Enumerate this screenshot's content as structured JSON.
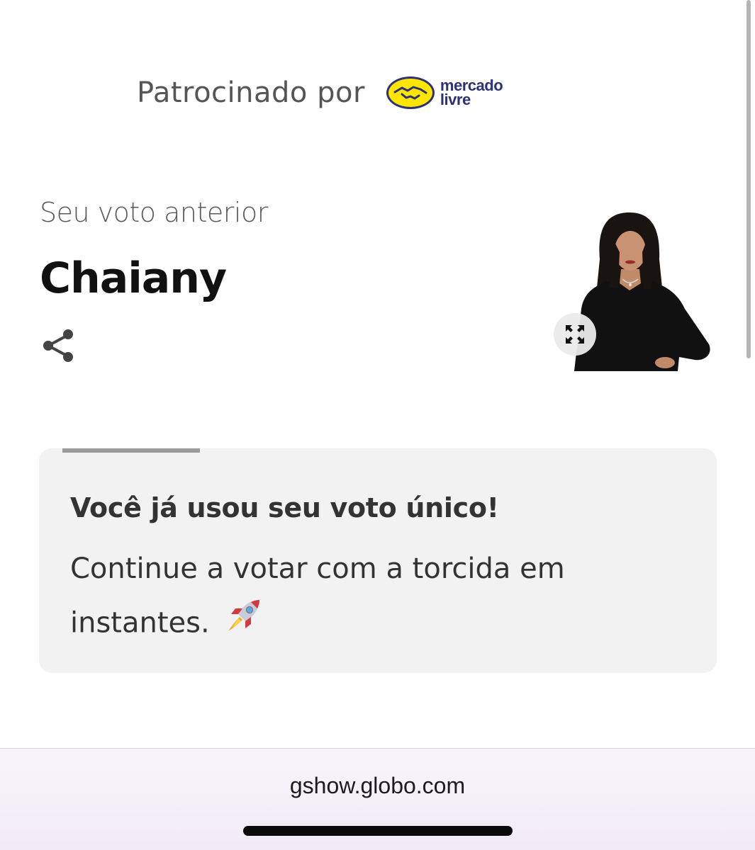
{
  "sponsor": {
    "label": "Patrocinado por",
    "brand_line1": "mercado",
    "brand_line2": "livre",
    "brand_icon": "handshake-icon"
  },
  "previous_vote": {
    "label": "Seu voto anterior",
    "candidate": "Chaiany",
    "share_icon": "share-icon",
    "expand_icon": "expand-icon"
  },
  "notice": {
    "title": "Você já usou seu voto único!",
    "body": "Continue a votar com a torcida em instantes.",
    "emoji": "🚀",
    "timer_progress": 0.45
  },
  "browser": {
    "url": "gshow.globo.com"
  },
  "colors": {
    "brand_yellow": "#ffe600",
    "brand_blue": "#2d3277",
    "card_bg": "#f2f2f2"
  }
}
